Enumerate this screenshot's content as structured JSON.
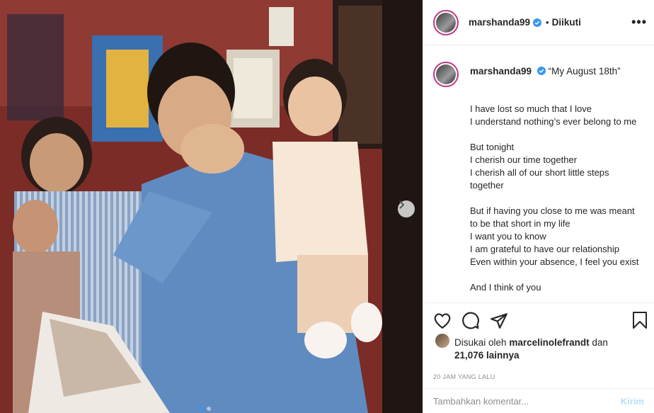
{
  "post": {
    "username": "marshanda99",
    "follow_separator": "•",
    "follow_status": "Diikuti",
    "more_label": "•••",
    "caption_title": "“My August 18th”",
    "caption_body": "I have lost so much that I love\nI understand nothing’s ever belong to me\n\nBut tonight\nI cherish our time together\nI cherish all of our short little steps together\n\nBut if having you close to me was meant to be that short in my life\nI want you to know\nI am grateful to have our relationship\nEven within your absence, I feel you exist\n\nAnd I think of you",
    "liked_prefix": "Disukai oleh",
    "liked_by": "marcelinolefrandt",
    "liked_and": "dan",
    "likes_count": "21,076 lainnya",
    "timestamp": "20 JAM YANG LALU",
    "comment_placeholder": "Tambahkan komentar...",
    "post_button": "Kirim"
  },
  "carousel": {
    "slide_count": 2,
    "active_slide": 1
  },
  "colors": {
    "accent": "#3897f0",
    "verified": "#3897f0",
    "post_button": "#b2dffc"
  }
}
